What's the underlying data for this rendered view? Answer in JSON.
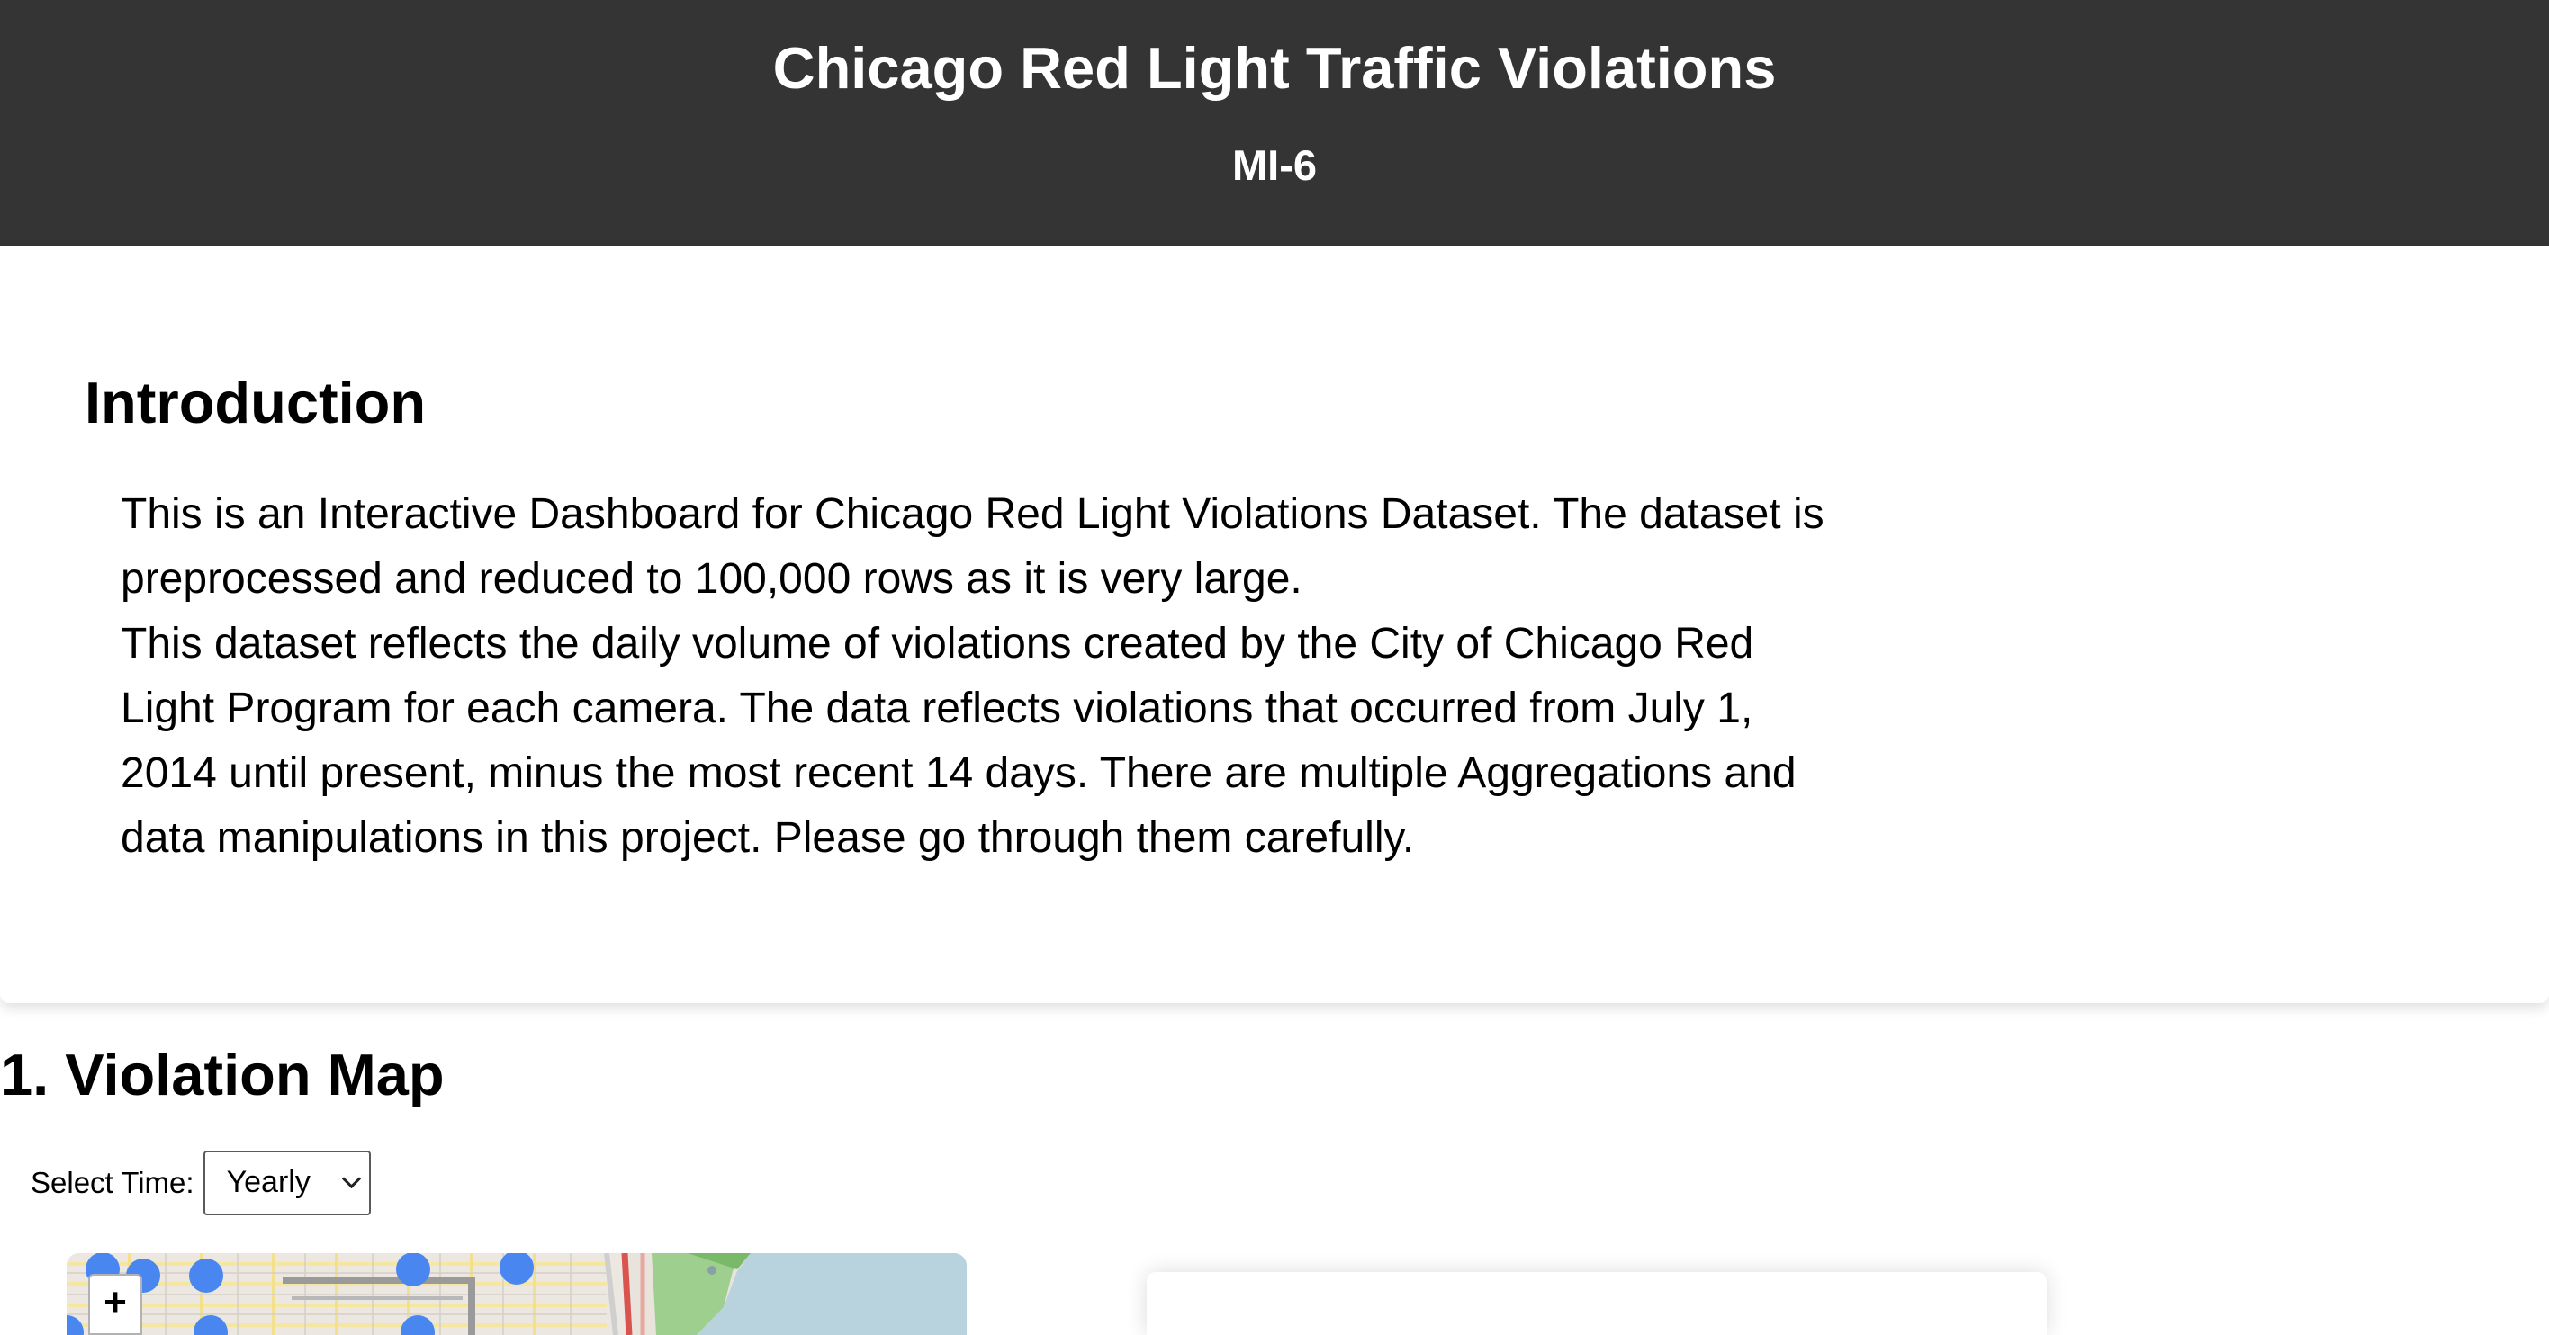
{
  "header": {
    "title": "Chicago Red Light Traffic Violations",
    "subtitle": "MI-6"
  },
  "intro": {
    "heading": "Introduction",
    "paragraph_1": "This is an Interactive Dashboard for Chicago Red Light Violations Dataset. The dataset is preprocessed and reduced to 100,000 rows as it is very large.",
    "paragraph_2": "This dataset reflects the daily volume of violations created by the City of Chicago Red Light Program for each camera. The data reflects violations that occurred from July 1, 2014 until present, minus the most recent 14 days. There are multiple Aggregations and data manipulations in this project. Please go through them carefully."
  },
  "violation_map": {
    "heading": "1. Violation Map",
    "select_label": "Select Time:",
    "select_value": "Yearly",
    "zoom_in_label": "+",
    "marker_color": "#4a86f0",
    "icons": [
      "zoom-in-icon",
      "chevron-down-icon"
    ]
  },
  "colors": {
    "header_background": "#343434",
    "header_text": "#ffffff",
    "marker": "#4a86f0"
  }
}
